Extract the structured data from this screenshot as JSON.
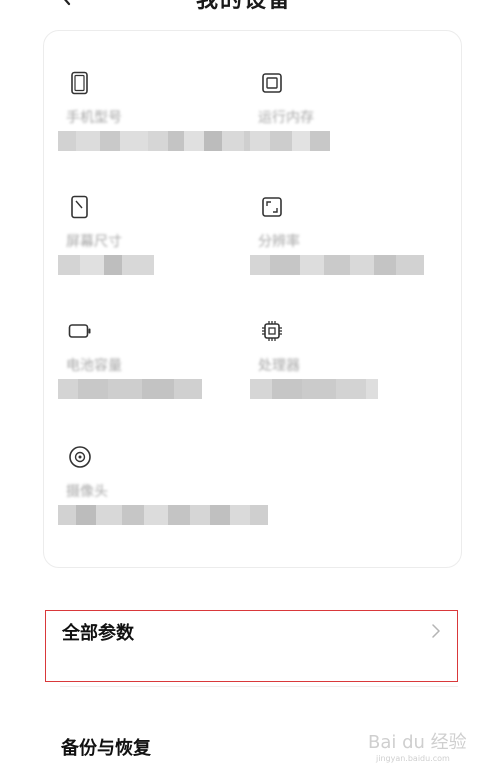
{
  "header": {
    "title": "我的设备"
  },
  "specs": [
    {
      "label": "手机型号",
      "icon": "phone-outline-icon"
    },
    {
      "label": "运行内存",
      "icon": "memory-chip-icon"
    },
    {
      "label": "屏幕尺寸",
      "icon": "screen-size-icon"
    },
    {
      "label": "分辨率",
      "icon": "resolution-icon"
    },
    {
      "label": "电池容量",
      "icon": "battery-icon"
    },
    {
      "label": "处理器",
      "icon": "processor-icon"
    },
    {
      "label": "摄像头",
      "icon": "camera-icon"
    }
  ],
  "rows": {
    "all_params": "全部参数",
    "backup": "备份与恢复"
  },
  "watermark": {
    "brand": "Bai du 经验",
    "url": "jingyan.baidu.com"
  },
  "colors": {
    "highlight_border": "#d9383a",
    "label_gray": "#a6a6a6"
  }
}
